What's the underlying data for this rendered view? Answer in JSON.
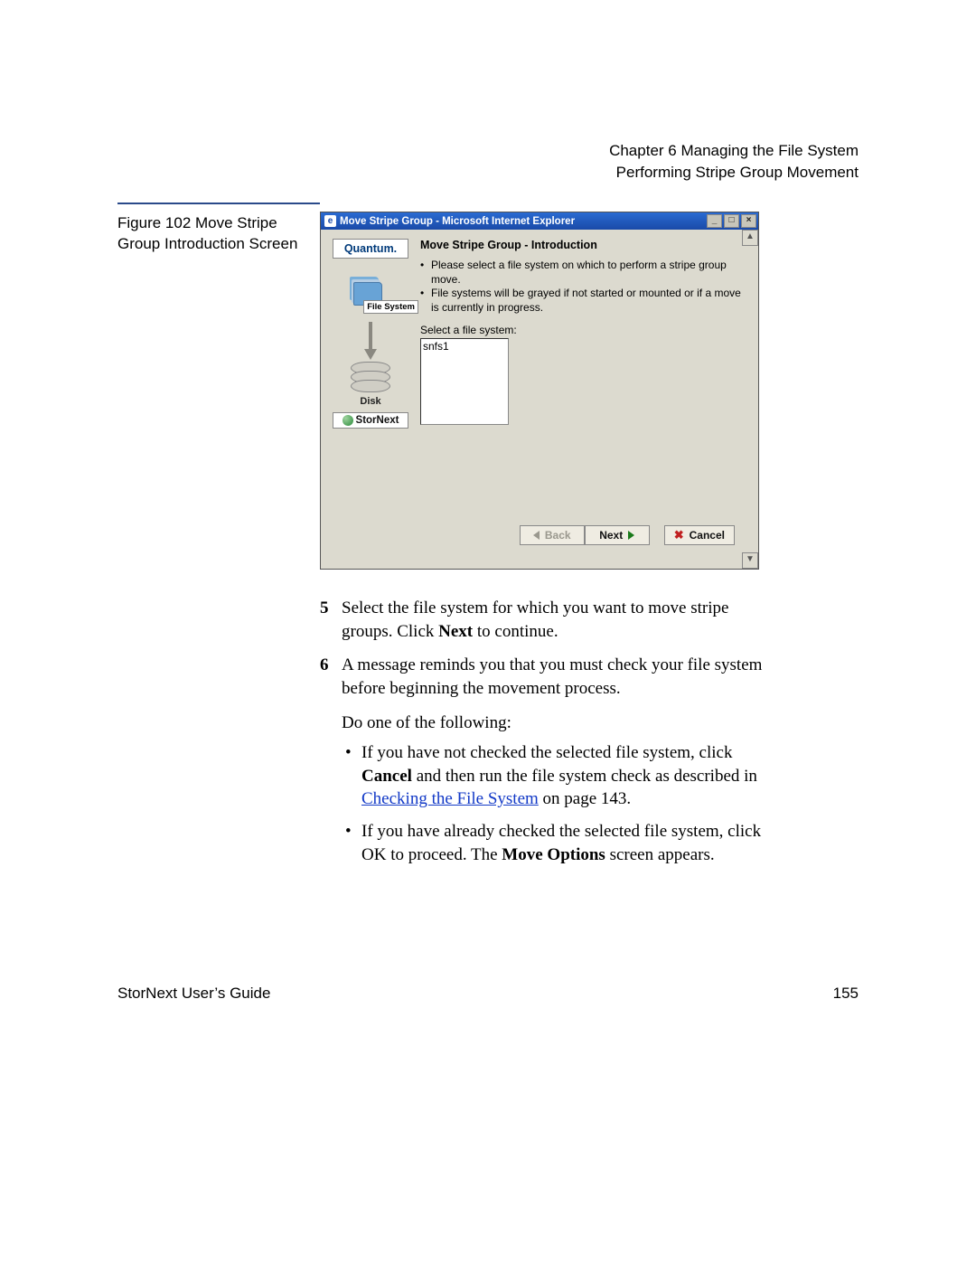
{
  "header": {
    "chapter_line": "Chapter 6  Managing the File System",
    "section_line": "Performing Stripe Group Movement"
  },
  "figure": {
    "caption_line1": "Figure 102  Move Stripe Group",
    "caption_line2": "Introduction Screen"
  },
  "window": {
    "title": "Move Stripe Group - Microsoft Internet Explorer",
    "side": {
      "brand": "Quantum.",
      "fs_label": "File System",
      "disk_label": "Disk",
      "product": "StorNext"
    },
    "intro": {
      "heading": "Move Stripe Group - Introduction",
      "bullet1": "Please select a file system on which to perform a stripe group move.",
      "bullet2": "File systems will be grayed if not started or mounted or if a move is currently in progress.",
      "select_label": "Select a file system:",
      "filesystems": [
        "snfs1"
      ]
    },
    "buttons": {
      "back": "Back",
      "next": "Next",
      "cancel": "Cancel"
    }
  },
  "body": {
    "step5_num": "5",
    "step5_text_a": "Select the file system for which you want to move stripe groups. Click ",
    "step5_bold": "Next",
    "step5_text_b": " to continue.",
    "step6_num": "6",
    "step6_text": "A message reminds you that you must check your file system before beginning the movement process.",
    "do_one": "Do one of the following:",
    "b1_a": "If you have not checked the selected file system, click ",
    "b1_bold": "Cancel",
    "b1_b": " and then run the file system check as described in ",
    "b1_link": "Checking the File System",
    "b1_c": " on page  143.",
    "b2_a": "If you have already checked the selected file system, click OK to proceed. The ",
    "b2_bold": "Move Options",
    "b2_b": " screen appears."
  },
  "footer": {
    "left": "StorNext User’s Guide",
    "page": "155"
  }
}
